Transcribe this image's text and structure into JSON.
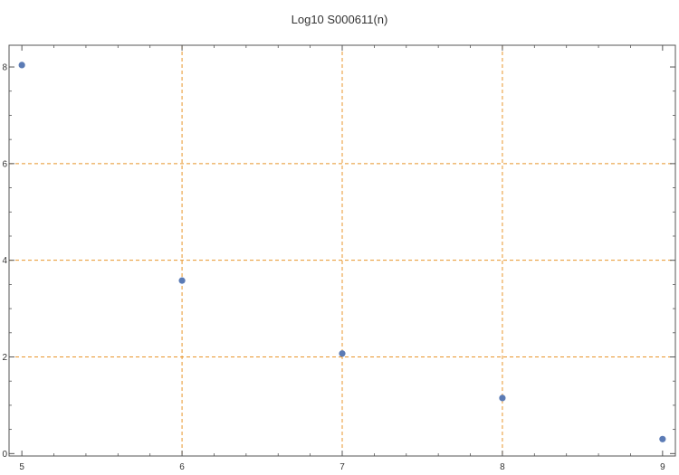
{
  "chart_data": {
    "type": "scatter",
    "title": "Log10 S000611(n)",
    "xlabel": "",
    "ylabel": "",
    "xlim": [
      4.92,
      9.08
    ],
    "ylim": [
      -0.05,
      8.45
    ],
    "x_ticks": [
      5,
      6,
      7,
      8,
      9
    ],
    "y_ticks": [
      0,
      2,
      4,
      6,
      8
    ],
    "x_tick_labels": [
      "5",
      "6",
      "7",
      "8",
      "9"
    ],
    "y_tick_labels": [
      "0",
      "2",
      "4",
      "6",
      "8"
    ],
    "grid": true,
    "x_grid": [
      6,
      7,
      8
    ],
    "y_grid": [
      2,
      4,
      6
    ],
    "series": [
      {
        "x": [
          5,
          6,
          7,
          8,
          9
        ],
        "y": [
          8.04,
          3.58,
          2.07,
          1.15,
          0.3
        ]
      }
    ],
    "colors": {
      "point": "#5b7bb5",
      "grid": "#e8952b",
      "axis": "#555555",
      "text": "#333333"
    }
  }
}
